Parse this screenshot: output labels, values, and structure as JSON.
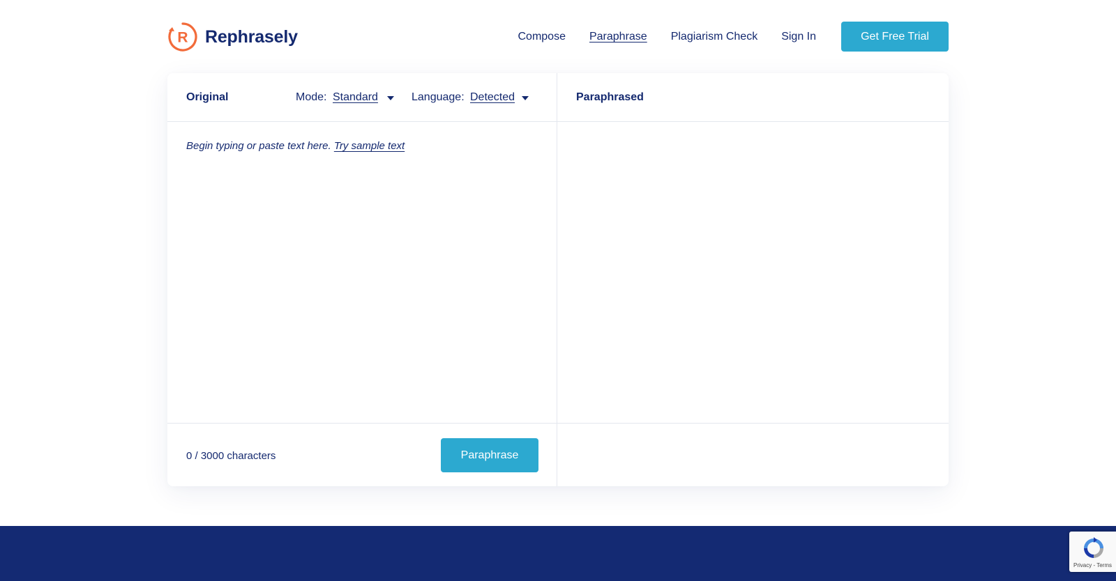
{
  "brand": {
    "name": "Rephrasely",
    "logo_letter": "R",
    "colors": {
      "navy": "#14296f",
      "accent": "#2ca9d0",
      "logo_orange": "#f26b3a",
      "band": "#142a73"
    }
  },
  "nav": {
    "links": [
      "Compose",
      "Paraphrase",
      "Plagiarism Check",
      "Sign In"
    ],
    "active": "Paraphrase",
    "cta_label": "Get Free Trial"
  },
  "editor": {
    "left": {
      "title": "Original",
      "mode_label": "Mode:",
      "mode_value": "Standard",
      "language_label": "Language:",
      "language_value": "Detected",
      "placeholder": "Begin typing or paste text here.",
      "sample_link": "Try sample text",
      "char_count": "0 / 3000 characters",
      "button_label": "Paraphrase"
    },
    "right": {
      "title": "Paraphrased"
    }
  },
  "recaptcha": {
    "terms": "Privacy - Terms",
    "icon": "recaptcha-icon"
  }
}
